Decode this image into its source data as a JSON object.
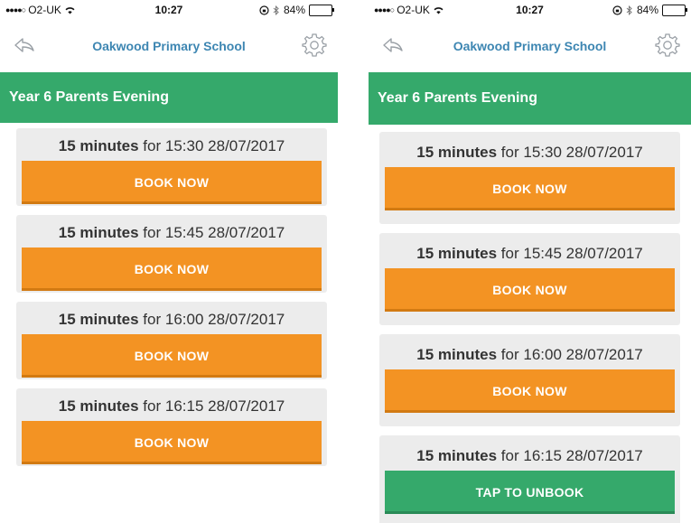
{
  "colors": {
    "accent_green": "#35a96b",
    "book_orange": "#f39323",
    "title_blue": "#3d86b2",
    "card_grey": "#ececec"
  },
  "screens": [
    {
      "status_bar": {
        "carrier": "O2-UK",
        "time": "10:27",
        "battery": "84%",
        "icons": [
          "signal-dots-icon",
          "wifi-icon",
          "orientation-lock-icon",
          "bluetooth-icon",
          "battery-icon"
        ]
      },
      "nav": {
        "title": "Oakwood Primary School",
        "back_icon": "back-arrow-icon",
        "settings_icon": "gear-icon"
      },
      "section_title": "Year 6 Parents Evening",
      "slots": [
        {
          "duration": "15 minutes",
          "connector": "for",
          "time": "15:30",
          "date": "28/07/2017",
          "button": "BOOK NOW",
          "state": "available"
        },
        {
          "duration": "15 minutes",
          "connector": "for",
          "time": "15:45",
          "date": "28/07/2017",
          "button": "BOOK NOW",
          "state": "available"
        },
        {
          "duration": "15 minutes",
          "connector": "for",
          "time": "16:00",
          "date": "28/07/2017",
          "button": "BOOK NOW",
          "state": "available"
        },
        {
          "duration": "15 minutes",
          "connector": "for",
          "time": "16:15",
          "date": "28/07/2017",
          "button": "BOOK NOW",
          "state": "available"
        }
      ]
    },
    {
      "status_bar": {
        "carrier": "O2-UK",
        "time": "10:27",
        "battery": "84%",
        "icons": [
          "signal-dots-icon",
          "wifi-icon",
          "orientation-lock-icon",
          "bluetooth-icon",
          "battery-icon"
        ]
      },
      "nav": {
        "title": "Oakwood Primary School",
        "back_icon": "back-arrow-icon",
        "settings_icon": "gear-icon"
      },
      "section_title": "Year 6 Parents Evening",
      "slots": [
        {
          "duration": "15 minutes",
          "connector": "for",
          "time": "15:30",
          "date": "28/07/2017",
          "button": "BOOK NOW",
          "state": "available"
        },
        {
          "duration": "15 minutes",
          "connector": "for",
          "time": "15:45",
          "date": "28/07/2017",
          "button": "BOOK NOW",
          "state": "available"
        },
        {
          "duration": "15 minutes",
          "connector": "for",
          "time": "16:00",
          "date": "28/07/2017",
          "button": "BOOK NOW",
          "state": "available"
        },
        {
          "duration": "15 minutes",
          "connector": "for",
          "time": "16:15",
          "date": "28/07/2017",
          "button": "TAP TO UNBOOK",
          "state": "booked"
        }
      ]
    }
  ]
}
